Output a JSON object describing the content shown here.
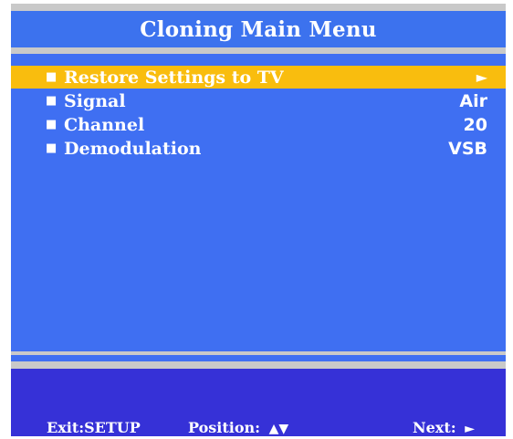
{
  "title": "Cloning Main Menu",
  "menu": {
    "bullet": "■",
    "items": [
      {
        "label": "Restore Settings to TV",
        "value": "►",
        "selected": true
      },
      {
        "label": "Signal",
        "value": "Air",
        "selected": false
      },
      {
        "label": "Channel",
        "value": "20",
        "selected": false
      },
      {
        "label": "Demodulation",
        "value": "VSB",
        "selected": false
      }
    ]
  },
  "footer": {
    "exit_label": "Exit:",
    "exit_key": "SETUP",
    "position_label": "Position:",
    "position_glyph": "▲▼",
    "next_label": "Next:",
    "next_glyph": "►"
  },
  "colors": {
    "background": "#3f6ff2",
    "title_bar": "#3c72ee",
    "highlight": "#f9bd0e",
    "footer": "#3631d7",
    "divider": "#c9c9c9"
  }
}
